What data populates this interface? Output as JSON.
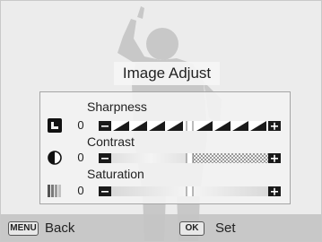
{
  "screen": {
    "title": "Image Adjust"
  },
  "adjustments": [
    {
      "label": "Sharpness",
      "value": "0",
      "icon": "sharpness-icon",
      "level": 0.5
    },
    {
      "label": "Contrast",
      "value": "0",
      "icon": "contrast-icon",
      "level": 0.5
    },
    {
      "label": "Saturation",
      "value": "0",
      "icon": "saturation-icon",
      "level": 0.5
    }
  ],
  "bottom_bar": {
    "menu_key": "MENU",
    "menu_label": "Back",
    "ok_key": "OK",
    "ok_label": "Set"
  },
  "colors": {
    "background": "#ececec",
    "silhouette": "#c8c8c8",
    "bottom_bar": "#c4c4c4",
    "slider_dark": "#1a1a1a"
  }
}
